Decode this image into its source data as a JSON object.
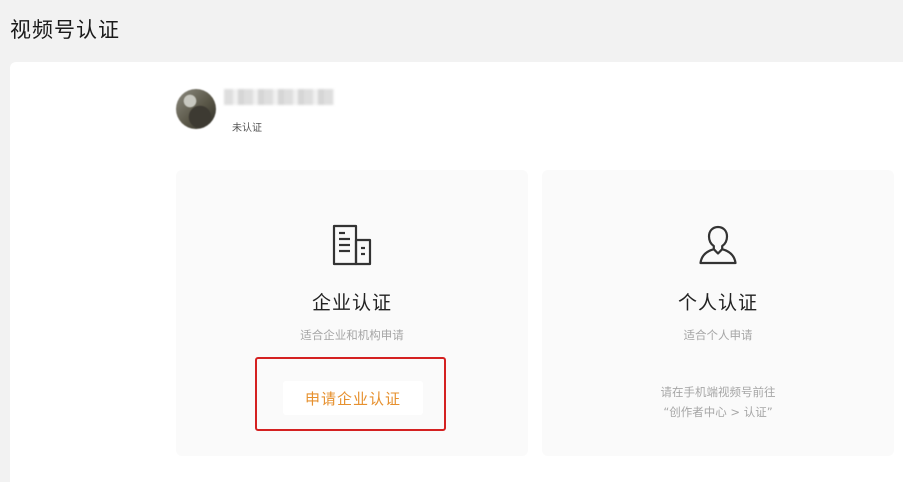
{
  "header": {
    "title": "视频号认证"
  },
  "profile": {
    "status": "未认证"
  },
  "cards": {
    "enterprise": {
      "icon": "building-icon",
      "title": "企业认证",
      "subtitle": "适合企业和机构申请",
      "button_label": "申请企业认证",
      "button_color": "#e6902e",
      "highlight_color": "#d42121"
    },
    "personal": {
      "icon": "person-icon",
      "title": "个人认证",
      "subtitle": "适合个人申请",
      "hint_line1": "请在手机端视频号前往",
      "hint_line2": "“创作者中心 > 认证”"
    }
  }
}
